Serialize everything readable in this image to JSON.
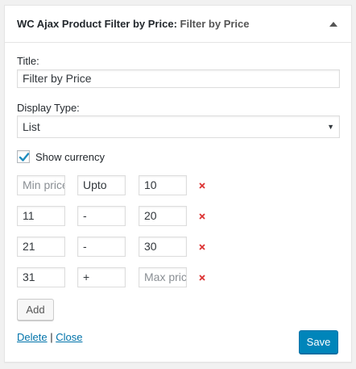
{
  "widget": {
    "title_main": "WC Ajax Product Filter by Price",
    "title_sep": ":",
    "title_sub": " Filter by Price"
  },
  "form": {
    "title_label": "Title:",
    "title_value": "Filter by Price",
    "display_type_label": "Display Type:",
    "display_type_value": "List",
    "show_currency_label": "Show currency",
    "show_currency_checked": true
  },
  "ranges": [
    {
      "min": "",
      "min_placeholder": "Min price",
      "sep": "Upto",
      "max": "10",
      "max_placeholder": ""
    },
    {
      "min": "11",
      "min_placeholder": "",
      "sep": "-",
      "max": "20",
      "max_placeholder": ""
    },
    {
      "min": "21",
      "min_placeholder": "",
      "sep": "-",
      "max": "30",
      "max_placeholder": ""
    },
    {
      "min": "31",
      "min_placeholder": "",
      "sep": "+",
      "max": "",
      "max_placeholder": "Max price"
    }
  ],
  "actions": {
    "add_label": "Add",
    "delete_label": "Delete",
    "link_sep": " | ",
    "close_label": "Close",
    "save_label": "Save"
  },
  "colors": {
    "accent": "#0085ba",
    "link": "#0073aa",
    "remove": "#dc3232"
  }
}
